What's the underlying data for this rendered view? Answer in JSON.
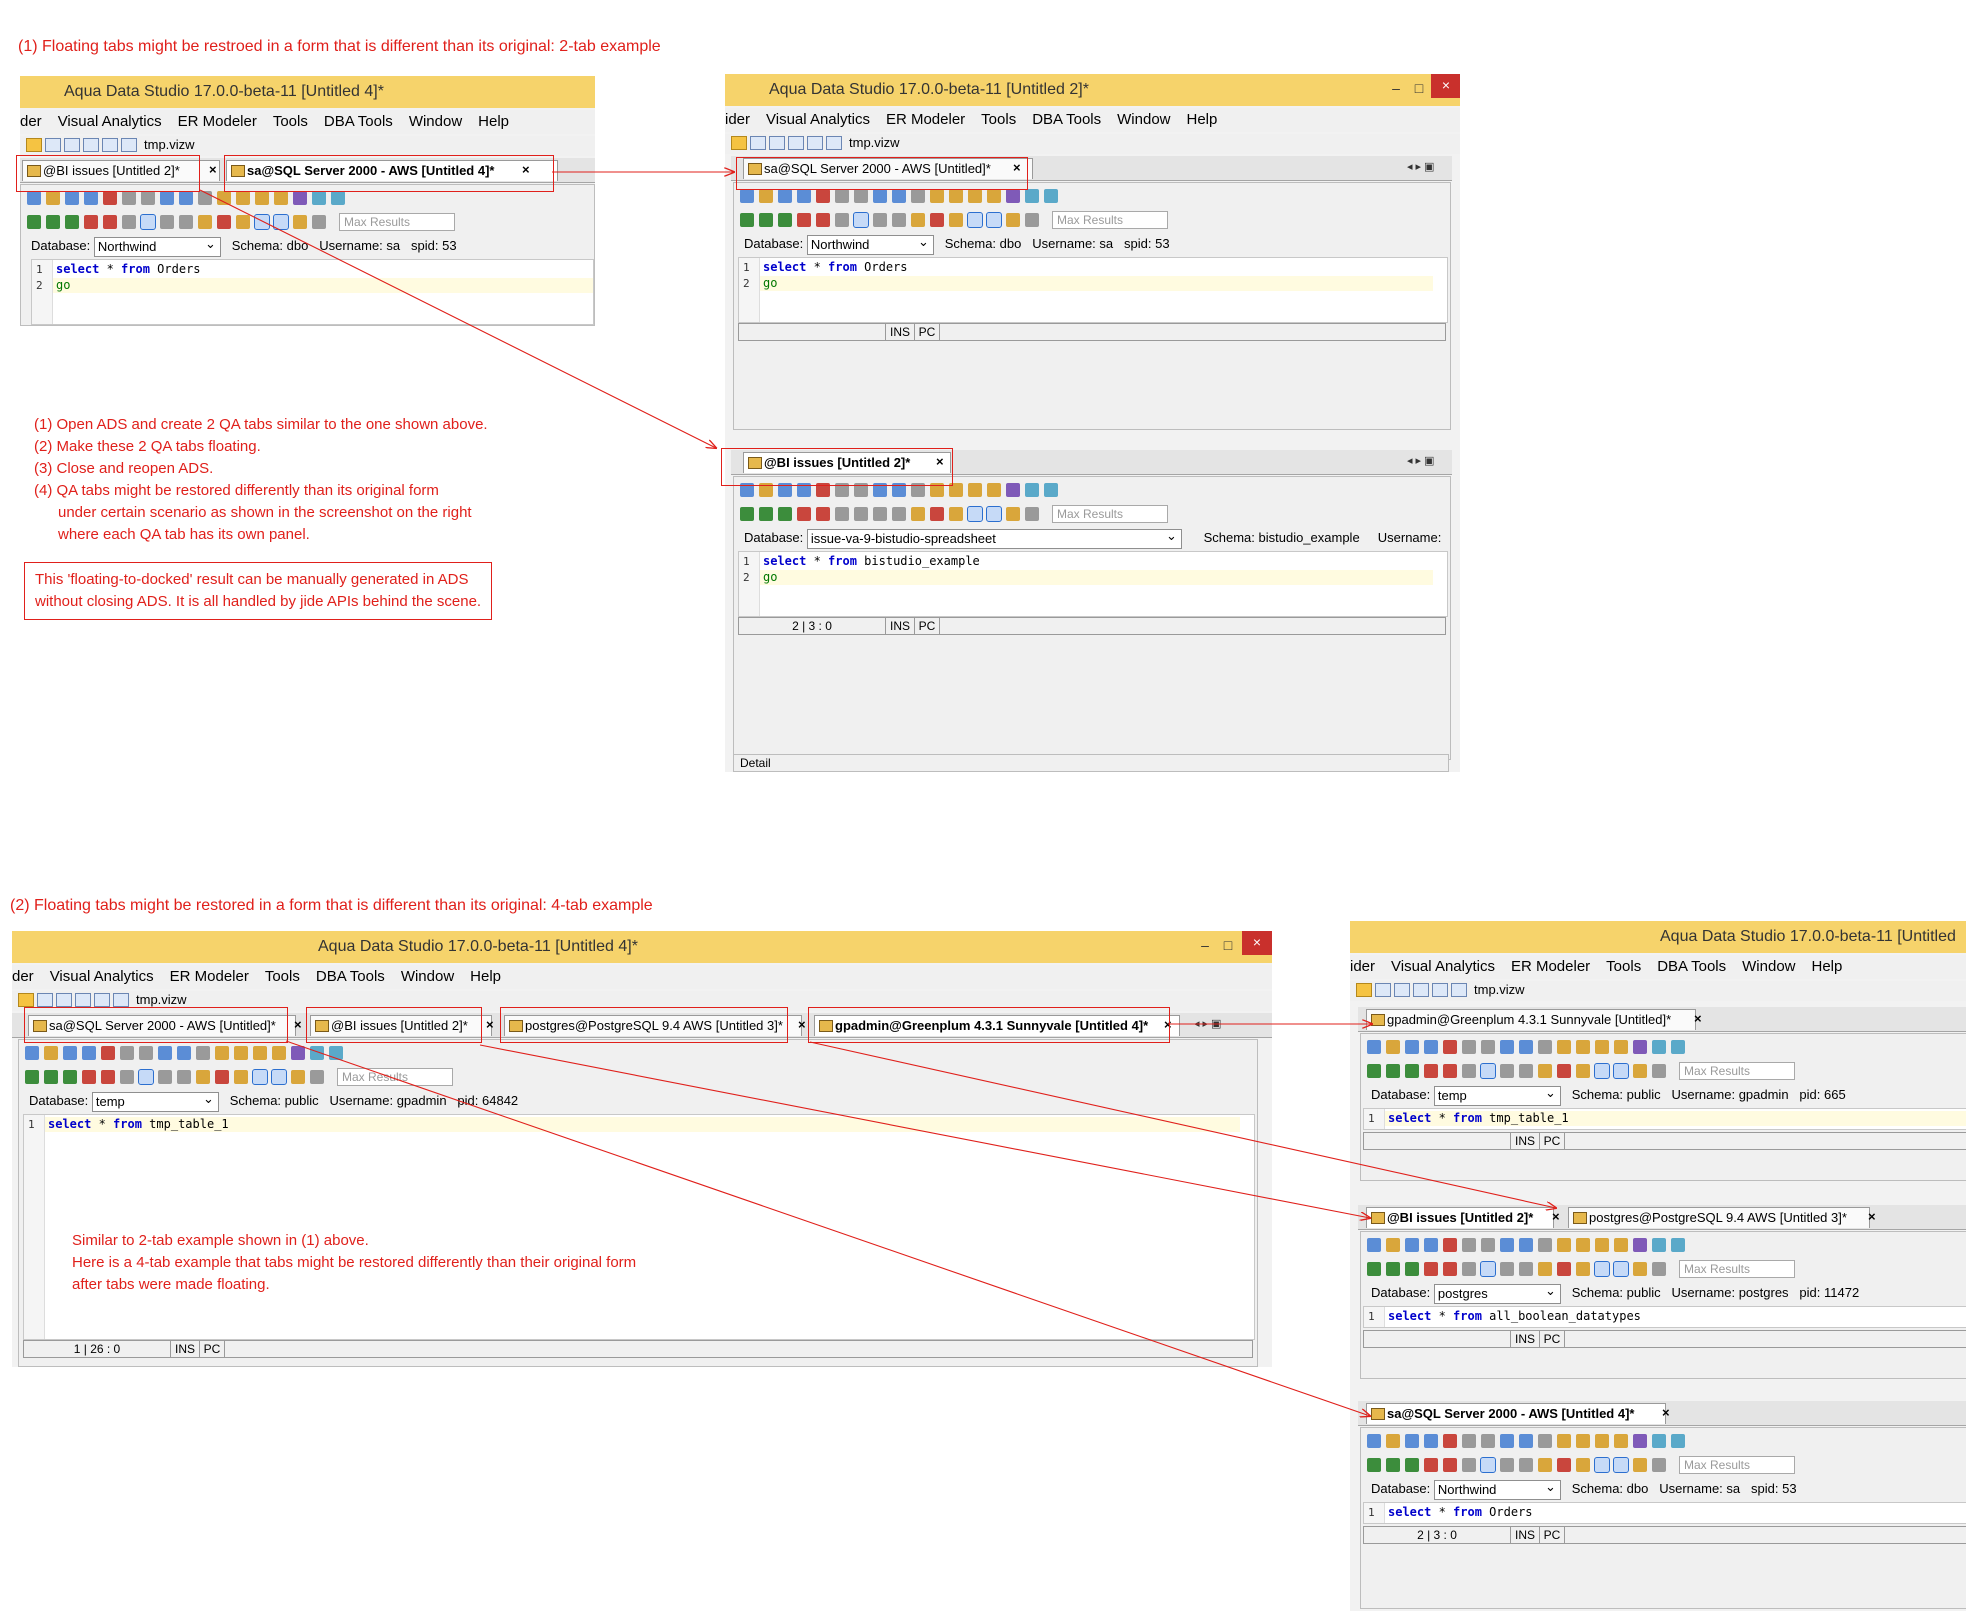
{
  "captions": {
    "top": "(1) Floating tabs might be restroed in a form that is different than its original:  2-tab example",
    "bottom": "(2) Floating tabs might be restored in a form that is different than its original:  4-tab example"
  },
  "instructions": [
    "(1) Open ADS and create 2 QA tabs similar to the one shown above.",
    "(2) Make these 2 QA tabs floating.",
    "(3) Close and reopen ADS.",
    "(4) QA tabs might be restored differently than its original form",
    "      under certain scenario as shown in the screenshot on the right",
    "      where each QA tab has its own panel."
  ],
  "note_box": [
    "This 'floating-to-docked' result can be manually generated in ADS",
    "without closing ADS. It is all handled by jide APIs behind the scene."
  ],
  "bottom_note": [
    "Similar to 2-tab example shown in (1) above.",
    "Here is a 4-tab example that tabs might be restored differently than their original form",
    "after tabs were made floating."
  ],
  "menu": [
    "ider",
    "Visual Analytics",
    "ER Modeler",
    "Tools",
    "DBA Tools",
    "Window",
    "Help"
  ],
  "menu_left": [
    "der",
    "Visual Analytics",
    "ER Modeler",
    "Tools",
    "DBA Tools",
    "Window",
    "Help"
  ],
  "file": "tmp.vizw",
  "common": {
    "max_results": "Max Results",
    "database_label": "Database:",
    "schema_label": "Schema:",
    "username_label": "Username:",
    "ins": "INS",
    "pc": "PC",
    "detail": "Detail",
    "close": "×"
  },
  "win1": {
    "title": "Aqua Data Studio 17.0.0-beta-11 [Untitled 4]*",
    "tab1": "@BI issues [Untitled 2]*",
    "tab2": "sa@SQL Server 2000 - AWS [Untitled 4]*",
    "database": "Northwind",
    "schema": "dbo",
    "username": "sa",
    "spid_label": "spid:",
    "spid": "53",
    "line1_kw1": "select",
    "line1_mid": " * ",
    "line1_kw2": "from",
    "line1_rest": " Orders",
    "line2": "go"
  },
  "win2": {
    "title": "Aqua Data Studio 17.0.0-beta-11 [Untitled 2]*",
    "panel1_tab": "sa@SQL Server 2000 - AWS [Untitled]*",
    "panel1": {
      "database": "Northwind",
      "schema": "dbo",
      "username": "sa",
      "spid_label": "spid:",
      "spid": "53",
      "line1_kw1": "select",
      "line1_mid": " * ",
      "line1_kw2": "from",
      "line1_rest": " Orders",
      "line2": "go"
    },
    "panel2_tab": "@BI issues [Untitled 2]*",
    "panel2": {
      "database": "issue-va-9-bistudio-spreadsheet",
      "schema": "bistudio_example",
      "line1_kw1": "select",
      "line1_mid": " * ",
      "line1_kw2": "from",
      "line1_rest": " bistudio_example",
      "line2": "go",
      "pos": "2 | 3 : 0"
    }
  },
  "win3": {
    "title": "Aqua Data Studio 17.0.0-beta-11 [Untitled 4]*",
    "tabs": [
      "sa@SQL Server 2000 - AWS [Untitled]*",
      "@BI issues [Untitled 2]*",
      "postgres@PostgreSQL 9.4 AWS [Untitled 3]*",
      "gpadmin@Greenplum 4.3.1 Sunnyvale [Untitled 4]*"
    ],
    "database": "temp",
    "schema": "public",
    "username": "gpadmin",
    "pid_label": "pid:",
    "pid": "64842",
    "line1_kw1": "select",
    "line1_mid": " * ",
    "line1_kw2": "from",
    "line1_rest": " tmp_table_1",
    "pos": "1 | 26 : 0"
  },
  "win4": {
    "title": "Aqua Data Studio 17.0.0-beta-11 [Untitled",
    "p1_tab": "gpadmin@Greenplum 4.3.1 Sunnyvale [Untitled]*",
    "p1": {
      "database": "temp",
      "schema": "public",
      "username": "gpadmin",
      "pid_label": "pid:",
      "pid": "665",
      "line1_kw1": "select",
      "line1_mid": " * ",
      "line1_kw2": "from",
      "line1_rest": " tmp_table_1"
    },
    "p2_tab1": "@BI issues [Untitled 2]*",
    "p2_tab2": "postgres@PostgreSQL 9.4 AWS [Untitled 3]*",
    "p2": {
      "database": "postgres",
      "schema": "public",
      "username": "postgres",
      "pid_label": "pid:",
      "pid": "11472",
      "line1_kw1": "select",
      "line1_mid": " * ",
      "line1_kw2": "from",
      "line1_rest": " all_boolean_datatypes"
    },
    "p3_tab": "sa@SQL Server 2000 - AWS [Untitled 4]*",
    "p3": {
      "database": "Northwind",
      "schema": "dbo",
      "username": "sa",
      "spid_label": "spid:",
      "spid": "53",
      "line1_kw1": "select",
      "line1_mid": " * ",
      "line1_kw2": "from",
      "line1_rest": " Orders",
      "pos": "2 | 3 : 0"
    }
  },
  "colors": {
    "annotation_red": "#e0201b",
    "titlebar": "#f6d36b",
    "close_button": "#c9302c"
  }
}
